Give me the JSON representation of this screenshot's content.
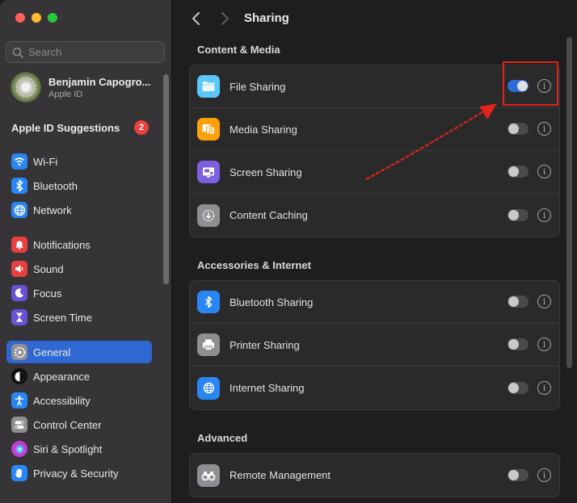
{
  "window": {
    "title": "Sharing"
  },
  "sidebar": {
    "search_placeholder": "Search",
    "profile": {
      "name": "Benjamin Capogro...",
      "subtitle": "Apple ID"
    },
    "suggestions": {
      "label": "Apple ID Suggestions",
      "count": "2"
    },
    "items": [
      {
        "label": "Wi-Fi",
        "icon": "wifi-icon",
        "color": "#2a86f5"
      },
      {
        "label": "Bluetooth",
        "icon": "bluetooth-icon",
        "color": "#2a86f5"
      },
      {
        "label": "Network",
        "icon": "globe-icon",
        "color": "#2a86f5"
      },
      {
        "label": "Notifications",
        "icon": "bell-icon",
        "color": "#e8403f"
      },
      {
        "label": "Sound",
        "icon": "speaker-icon",
        "color": "#e8403f"
      },
      {
        "label": "Focus",
        "icon": "moon-icon",
        "color": "#6a52d6"
      },
      {
        "label": "Screen Time",
        "icon": "hourglass-icon",
        "color": "#6a52d6"
      },
      {
        "label": "General",
        "icon": "gear-icon",
        "color": "#8e8e93",
        "active": true
      },
      {
        "label": "Appearance",
        "icon": "appearance-icon",
        "color": "#111111"
      },
      {
        "label": "Accessibility",
        "icon": "accessibility-icon",
        "color": "#2a86f5"
      },
      {
        "label": "Control Center",
        "icon": "control-center-icon",
        "color": "#8e8e93"
      },
      {
        "label": "Siri & Spotlight",
        "icon": "siri-icon",
        "color": "#c03fd1"
      },
      {
        "label": "Privacy & Security",
        "icon": "hand-icon",
        "color": "#2a86f5"
      }
    ]
  },
  "sections": [
    {
      "title": "Content & Media",
      "rows": [
        {
          "label": "File Sharing",
          "icon": "folder-icon",
          "color": "#5ac8fa",
          "enabled": true
        },
        {
          "label": "Media Sharing",
          "icon": "media-icon",
          "color": "#ff9f0a",
          "enabled": false
        },
        {
          "label": "Screen Sharing",
          "icon": "screen-sharing-icon",
          "color": "#7d5fe0",
          "enabled": false
        },
        {
          "label": "Content Caching",
          "icon": "download-icon",
          "color": "#8e8e93",
          "enabled": false
        }
      ]
    },
    {
      "title": "Accessories & Internet",
      "rows": [
        {
          "label": "Bluetooth Sharing",
          "icon": "bluetooth-icon",
          "color": "#2a86f5",
          "enabled": false
        },
        {
          "label": "Printer Sharing",
          "icon": "printer-icon",
          "color": "#8e8e93",
          "enabled": false
        },
        {
          "label": "Internet Sharing",
          "icon": "globe-icon",
          "color": "#2a86f5",
          "enabled": false
        }
      ]
    },
    {
      "title": "Advanced",
      "rows": [
        {
          "label": "Remote Management",
          "icon": "binoculars-icon",
          "color": "#8e8e93",
          "enabled": false
        }
      ]
    }
  ],
  "annotation": {
    "color": "#e0231c"
  }
}
